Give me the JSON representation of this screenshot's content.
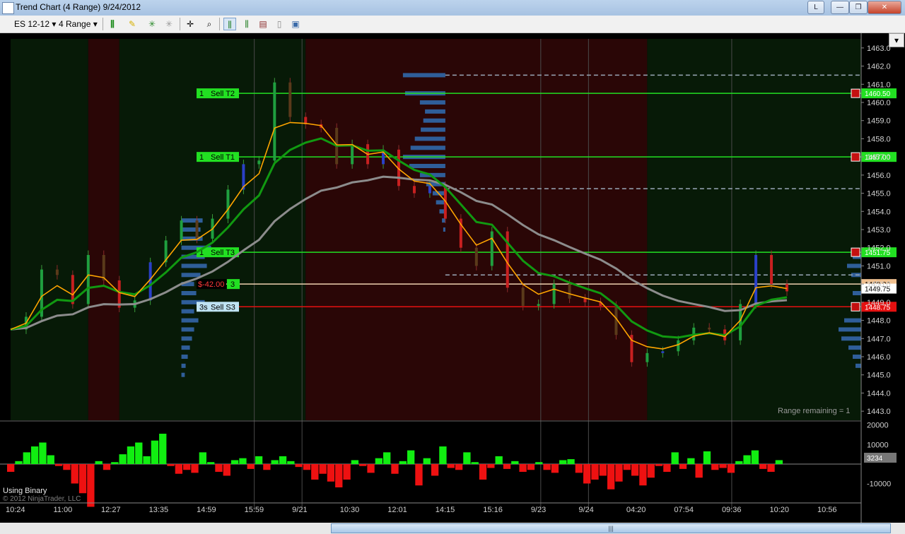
{
  "window": {
    "title": "Trend Chart (4 Range)  9/24/2012",
    "layout_badge": "L",
    "minimize": "—",
    "maximize": "❐",
    "close": "✕"
  },
  "toolbar": {
    "instrument": "ES 12-12",
    "period": "4 Range",
    "dropdown_arrow": "▾"
  },
  "colors": {
    "background": "#000000",
    "green_zone": "#071a07",
    "red_zone": "#2a0606",
    "buy_line": "#22e022",
    "sell_line": "#e51010",
    "volume_profile": "#2f5e99",
    "fast_ma": "#ffa500",
    "mid_ma": "#119911",
    "slow_ma": "#8c8c8c",
    "hist_pos": "#11ee11",
    "hist_neg": "#ee1111"
  },
  "chart_data": {
    "type": "candlestick",
    "price_axis": {
      "min": 1442.5,
      "max": 1463.5,
      "ticks": [
        "1463.0",
        "1462.0",
        "1461.0",
        "1460.0",
        "1459.0",
        "1458.0",
        "1457.0",
        "1456.0",
        "1455.0",
        "1454.0",
        "1453.0",
        "1452.0",
        "1451.0",
        "1450.0",
        "1449.0",
        "1448.0",
        "1447.0",
        "1446.0",
        "1445.0",
        "1444.0",
        "1443.0"
      ]
    },
    "time_axis": {
      "ticks": [
        "10:24",
        "11:00",
        "12:27",
        "13:35",
        "14:59",
        "15:59",
        "9/21",
        "10:30",
        "12:01",
        "14:15",
        "15:16",
        "9/23",
        "9/24",
        "04:20",
        "07:54",
        "09:36",
        "10:20",
        "10:56"
      ]
    },
    "close_path": [
      [
        1447.5,
        1448.2
      ],
      [
        1449.5,
        1450.8
      ],
      [
        1451.5,
        1450.5
      ],
      [
        1449.8,
        1448.9
      ],
      [
        1450.3,
        1451.6
      ],
      [
        1451.8,
        1450.2
      ],
      [
        1449.5,
        1448.7
      ],
      [
        1448.6,
        1449.1
      ],
      [
        1450.3,
        1451.2
      ],
      [
        1451.6,
        1452.4
      ],
      [
        1452.8,
        1453.5
      ],
      [
        1453.2,
        1452.5
      ],
      [
        1452.3,
        1453.6
      ],
      [
        1454.1,
        1455.2
      ],
      [
        1455.8,
        1456.6
      ],
      [
        1457.4,
        1456.8
      ],
      [
        1458.4,
        1461.1
      ],
      [
        1460.0,
        1459.2
      ],
      [
        1459.4,
        1458.8
      ],
      [
        1459.8,
        1458.6
      ],
      [
        1457.4,
        1456.6
      ],
      [
        1457.0,
        1457.7
      ],
      [
        1457.9,
        1456.6
      ],
      [
        1457.1,
        1457.4
      ],
      [
        1456.6,
        1455.4
      ],
      [
        1455.7,
        1455.0
      ],
      [
        1456.0,
        1455.4
      ],
      [
        1454.8,
        1453.6
      ],
      [
        1452.9,
        1452.0
      ],
      [
        1451.4,
        1451.0
      ],
      [
        1452.3,
        1452.9
      ],
      [
        1451.6,
        1449.8
      ],
      [
        1448.3,
        1448.8
      ],
      [
        1449.6,
        1448.9
      ],
      [
        1449.3,
        1450.0
      ],
      [
        1449.8,
        1449.2
      ],
      [
        1448.5,
        1449.0
      ],
      [
        1449.4,
        1448.8
      ],
      [
        1448.0,
        1447.2
      ],
      [
        1446.5,
        1445.7
      ],
      [
        1446.6,
        1446.2
      ],
      [
        1445.6,
        1446.3
      ],
      [
        1445.7,
        1446.9
      ],
      [
        1447.9,
        1447.6
      ],
      [
        1448.6,
        1447.5
      ],
      [
        1447.2,
        1446.9
      ],
      [
        1447.6,
        1448.9
      ],
      [
        1450.6,
        1451.6
      ],
      [
        1450.8,
        1450.0
      ],
      [
        1449.6
      ]
    ],
    "moving_averages": {
      "fast": "orange",
      "mid": "green",
      "slow": "gray"
    },
    "zones": [
      {
        "type": "green",
        "from_index": 0,
        "to_index": 5
      },
      {
        "type": "red",
        "from_index": 5,
        "to_index": 7
      },
      {
        "type": "green",
        "from_index": 7,
        "to_index": 19
      },
      {
        "type": "red",
        "from_index": 19,
        "to_index": 41
      },
      {
        "type": "green",
        "from_index": 41,
        "to_index": 50
      }
    ],
    "levels": [
      {
        "label_qty": "1",
        "label_name": "Sell T2",
        "price": 1460.5,
        "price_label": "1460.50",
        "color": "green"
      },
      {
        "label_qty": "1",
        "label_name": "Sell T1",
        "price": 1457.0,
        "price_label": "1457.00",
        "color": "green"
      },
      {
        "label_qty": "1",
        "label_name": "Sell T3",
        "price": 1451.75,
        "price_label": "1451.75",
        "color": "green"
      },
      {
        "label_qty": "3s",
        "label_name": "Sell S3",
        "price": 1448.75,
        "price_label": "1448.75",
        "color": "red"
      }
    ],
    "position_line": {
      "pnl": "$-42.00",
      "qty": "3",
      "price": 1450.0,
      "price_label": "1450.00"
    },
    "last_price": {
      "price": 1449.75,
      "label": "1449.75"
    },
    "dashed_levels": [
      1461.5,
      1455.25,
      1450.5
    ],
    "volume_profile": [
      [
        1461.5,
        1.0
      ],
      [
        1460.5,
        0.95
      ],
      [
        1460.0,
        0.6
      ],
      [
        1459.5,
        0.48
      ],
      [
        1459.0,
        0.52
      ],
      [
        1458.5,
        0.58
      ],
      [
        1458.0,
        0.72
      ],
      [
        1457.5,
        0.82
      ],
      [
        1457.0,
        1.0
      ],
      [
        1456.5,
        0.85
      ],
      [
        1456.0,
        0.6
      ],
      [
        1455.5,
        0.45
      ],
      [
        1455.0,
        0.3
      ],
      [
        1454.5,
        0.22
      ],
      [
        1454.0,
        0.14
      ],
      [
        1453.5,
        0.08
      ],
      [
        1453.0,
        0.05
      ]
    ],
    "range_remaining": "Range remaining = 1",
    "oscillator": {
      "ticks": [
        "20000",
        "10000",
        "-10000"
      ],
      "current": "3234",
      "label": "Using Binary",
      "min": -20000,
      "max": 22000,
      "values": [
        -4000,
        1500,
        6000,
        9000,
        11000,
        4500,
        -1000,
        -3000,
        -10000,
        -15000,
        -22000,
        1500,
        -3000,
        1000,
        5000,
        9000,
        11000,
        4000,
        12000,
        15500,
        -1000,
        -5000,
        -3000,
        -4500,
        6000,
        1000,
        -4000,
        -6000,
        2000,
        3000,
        -2500,
        4000,
        -3000,
        2000,
        4000,
        1500,
        -1500,
        -3000,
        -8000,
        -5000,
        -9000,
        -12000,
        -8000,
        2000,
        -1000,
        -4500,
        3000,
        6000,
        -5000,
        1500,
        7000,
        -11000,
        3000,
        -6000,
        9000,
        -2000,
        -3000,
        6000,
        1000,
        -8000,
        -2000,
        4000,
        -2500,
        1500,
        -4000,
        -3000,
        1000,
        -3000,
        -4500,
        2000,
        2500,
        -4500,
        -10000,
        -8000,
        -6000,
        -13000,
        -9000,
        -3000,
        -6000,
        -11000,
        -7000,
        -1000,
        -4000,
        6000,
        -2500,
        3000,
        -7000,
        6500,
        -3000,
        -2000,
        -4500,
        1500,
        4500,
        7000,
        -2500,
        -4000,
        2000
      ]
    },
    "copyright": "© 2012 NinjaTrader, LLC"
  }
}
